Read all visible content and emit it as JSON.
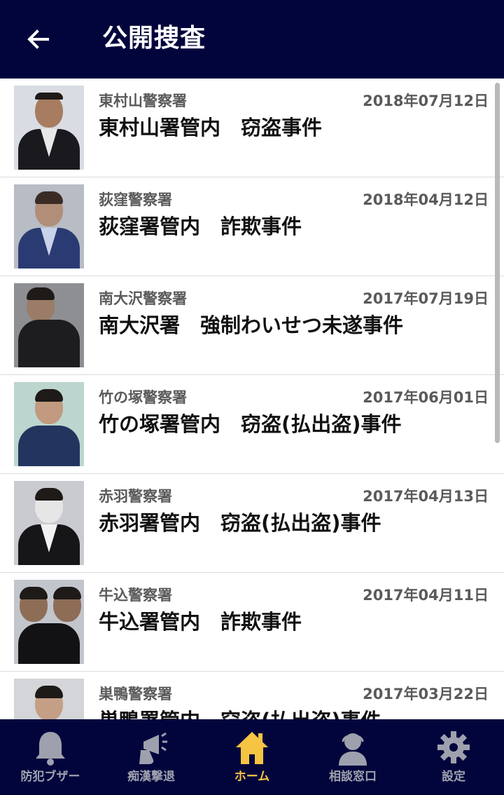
{
  "header": {
    "title": "公開捜査",
    "back_icon": "arrow-left-icon"
  },
  "colors": {
    "header_bg": "#02053c",
    "nav_bg": "#02053c",
    "nav_active": "#f6c443",
    "nav_inactive": "#9ea1ad"
  },
  "cases": [
    {
      "station": "東村山警察署",
      "date": "2018年07月12日",
      "title": "東村山署管内　窃盗事件"
    },
    {
      "station": "荻窪警察署",
      "date": "2018年04月12日",
      "title": "荻窪署管内　詐欺事件"
    },
    {
      "station": "南大沢警察署",
      "date": "2017年07月19日",
      "title": "南大沢署　強制わいせつ未遂事件"
    },
    {
      "station": "竹の塚警察署",
      "date": "2017年06月01日",
      "title": "竹の塚署管内　窃盗(払出盗)事件"
    },
    {
      "station": "赤羽警察署",
      "date": "2017年04月13日",
      "title": "赤羽署管内　窃盗(払出盗)事件"
    },
    {
      "station": "牛込警察署",
      "date": "2017年04月11日",
      "title": "牛込署管内　詐欺事件"
    },
    {
      "station": "巣鴨警察署",
      "date": "2017年03月22日",
      "title": "巣鴨署管内　窃盗(払出盗)事件"
    }
  ],
  "nav": [
    {
      "label": "防犯ブザー",
      "icon": "bell-icon"
    },
    {
      "label": "痴漢撃退",
      "icon": "megaphone-hand-icon"
    },
    {
      "label": "ホーム",
      "icon": "home-icon",
      "active": true
    },
    {
      "label": "相談窓口",
      "icon": "headset-person-icon"
    },
    {
      "label": "設定",
      "icon": "gear-icon"
    }
  ]
}
